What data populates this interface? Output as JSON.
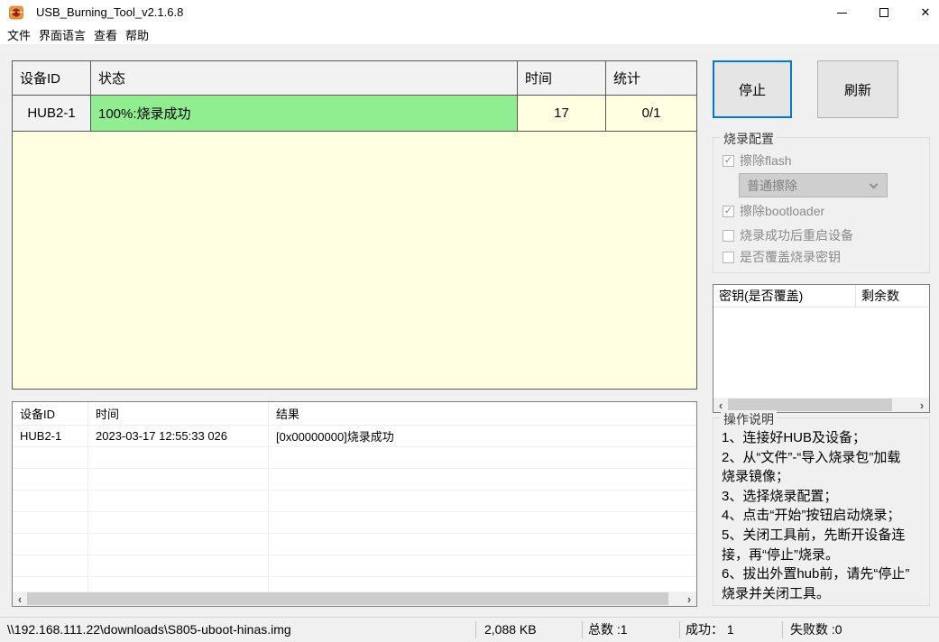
{
  "window": {
    "title": "USB_Burning_Tool_v2.1.6.8"
  },
  "menu": {
    "items": [
      "文件",
      "界面语言",
      "查看",
      "帮助"
    ]
  },
  "device_table": {
    "headers": {
      "id": "设备ID",
      "status": "状态",
      "time": "时间",
      "stats": "统计"
    },
    "row": {
      "id": "HUB2-1",
      "status": "100%:烧录成功",
      "time": "17",
      "stats": "0/1"
    }
  },
  "actions": {
    "stop": "停止",
    "refresh": "刷新"
  },
  "burn_config": {
    "title": "烧录配置",
    "erase_flash_label": "擦除flash",
    "erase_flash_checked": true,
    "erase_mode_selected": "普通擦除",
    "erase_bootloader_label": "擦除bootloader",
    "erase_bootloader_checked": true,
    "reboot_label": "烧录成功后重启设备",
    "reboot_checked": false,
    "overwrite_key_label": "是否覆盖烧录密钥",
    "overwrite_key_checked": false
  },
  "key_table": {
    "headers": {
      "key": "密钥(是否覆盖)",
      "remaining": "剩余数"
    }
  },
  "instructions": {
    "title": "操作说明",
    "lines": [
      "1、连接好HUB及设备；",
      "2、从“文件”-“导入烧录包”加载",
      "烧录镜像；",
      "3、选择烧录配置；",
      "4、点击“开始”按钮启动烧录；",
      "5、关闭工具前，先断开设备连",
      "接，再“停止”烧录。",
      "6、拔出外置hub前，请先“停止”",
      "烧录并关闭工具。"
    ]
  },
  "log_table": {
    "headers": {
      "id": "设备ID",
      "time": "时间",
      "result": "结果"
    },
    "row": {
      "id": "HUB2-1",
      "time": "2023-03-17 12:55:33 026",
      "result": "[0x00000000]烧录成功"
    }
  },
  "statusbar": {
    "path": "\\\\192.168.111.22\\downloads\\S805-uboot-hinas.img",
    "size": "2,088 KB",
    "total": "总数 :1",
    "success": "成功： 1",
    "failed": "失败数 :0"
  },
  "icons": {
    "close": "✕",
    "scroll_left": "‹",
    "scroll_right": "›",
    "check": "✓"
  },
  "colors": {
    "status_success_bg": "#90ee90",
    "table_empty_bg": "#ffffe1",
    "focus_border": "#0078d7"
  }
}
